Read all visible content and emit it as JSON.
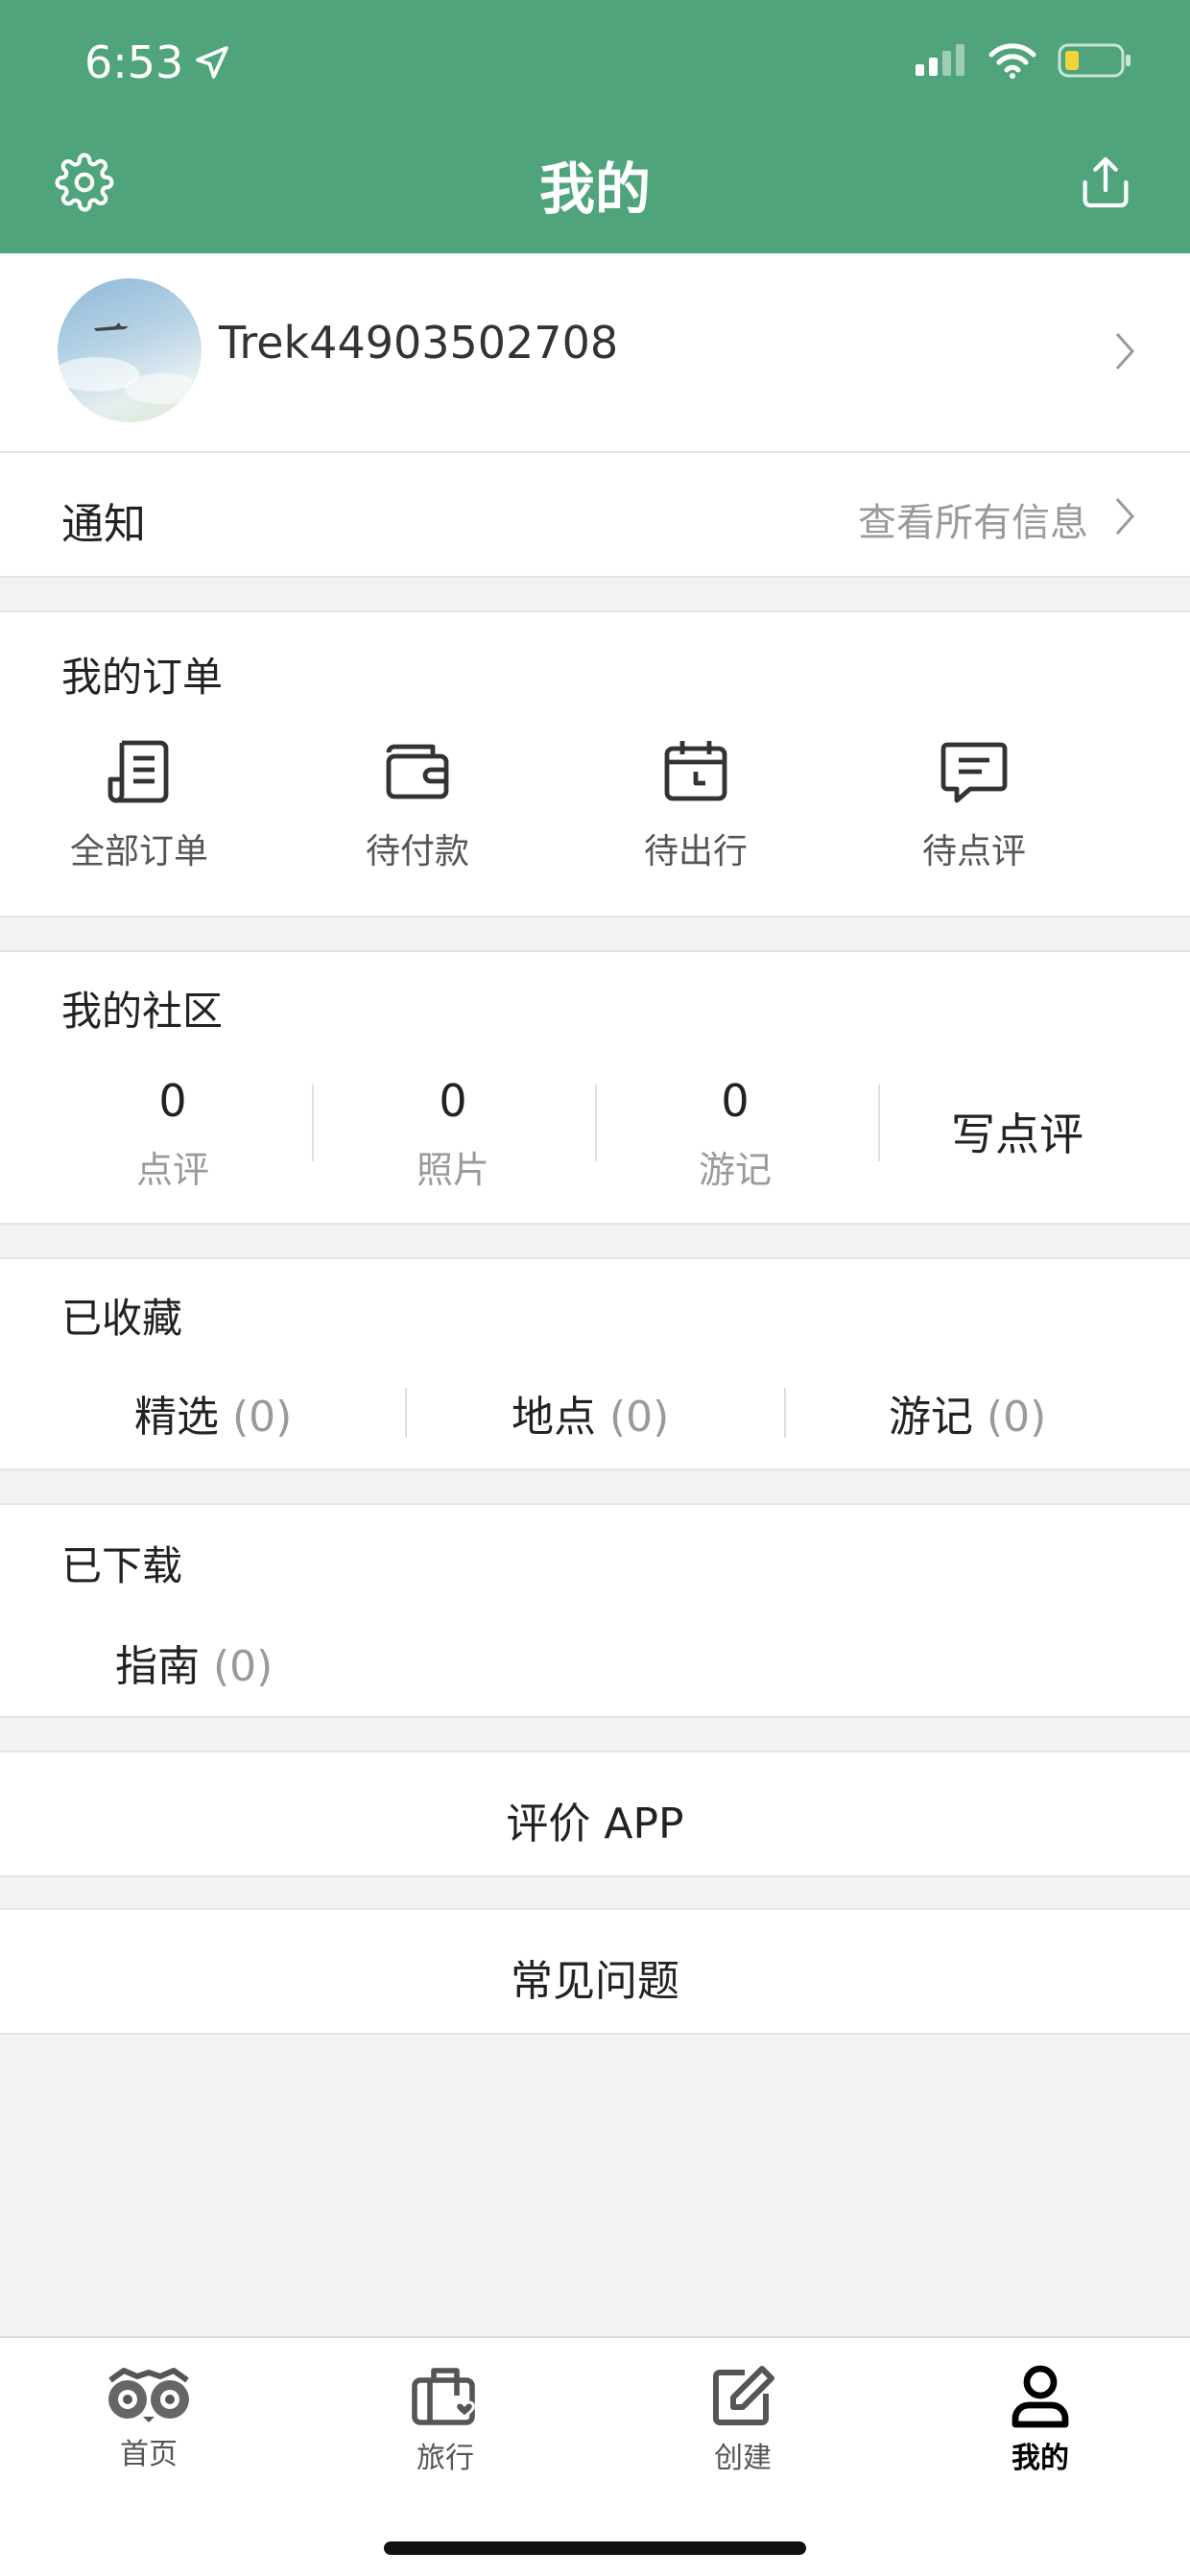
{
  "status_bar": {
    "time": "6:53"
  },
  "header": {
    "title": "我的"
  },
  "profile": {
    "username": "Trek44903502708"
  },
  "notifications": {
    "label": "通知",
    "link_text": "查看所有信息"
  },
  "orders": {
    "title": "我的订单",
    "items": [
      {
        "label": "全部订单",
        "icon": "document-list-icon"
      },
      {
        "label": "待付款",
        "icon": "wallet-icon"
      },
      {
        "label": "待出行",
        "icon": "calendar-icon"
      },
      {
        "label": "待点评",
        "icon": "chat-bubble-icon"
      }
    ]
  },
  "community": {
    "title": "我的社区",
    "stats": [
      {
        "count": "0",
        "label": "点评"
      },
      {
        "count": "0",
        "label": "照片"
      },
      {
        "count": "0",
        "label": "游记"
      }
    ],
    "write_review": "写点评"
  },
  "saved": {
    "title": "已收藏",
    "items": [
      {
        "label": "精选",
        "count": "(0)"
      },
      {
        "label": "地点",
        "count": "(0)"
      },
      {
        "label": "游记",
        "count": "(0)"
      }
    ]
  },
  "downloaded": {
    "title": "已下载",
    "items": [
      {
        "label": "指南",
        "count": "(0)"
      }
    ]
  },
  "rate_app": "评价 APP",
  "faq": "常见问题",
  "tabbar": {
    "items": [
      {
        "label": "首页",
        "icon": "owl-eyes-icon"
      },
      {
        "label": "旅行",
        "icon": "suitcase-heart-icon"
      },
      {
        "label": "创建",
        "icon": "edit-icon"
      },
      {
        "label": "我的",
        "icon": "person-icon",
        "active": true
      }
    ]
  },
  "colors": {
    "brand_green": "#4fa47c",
    "background": "#f2f2f2"
  }
}
